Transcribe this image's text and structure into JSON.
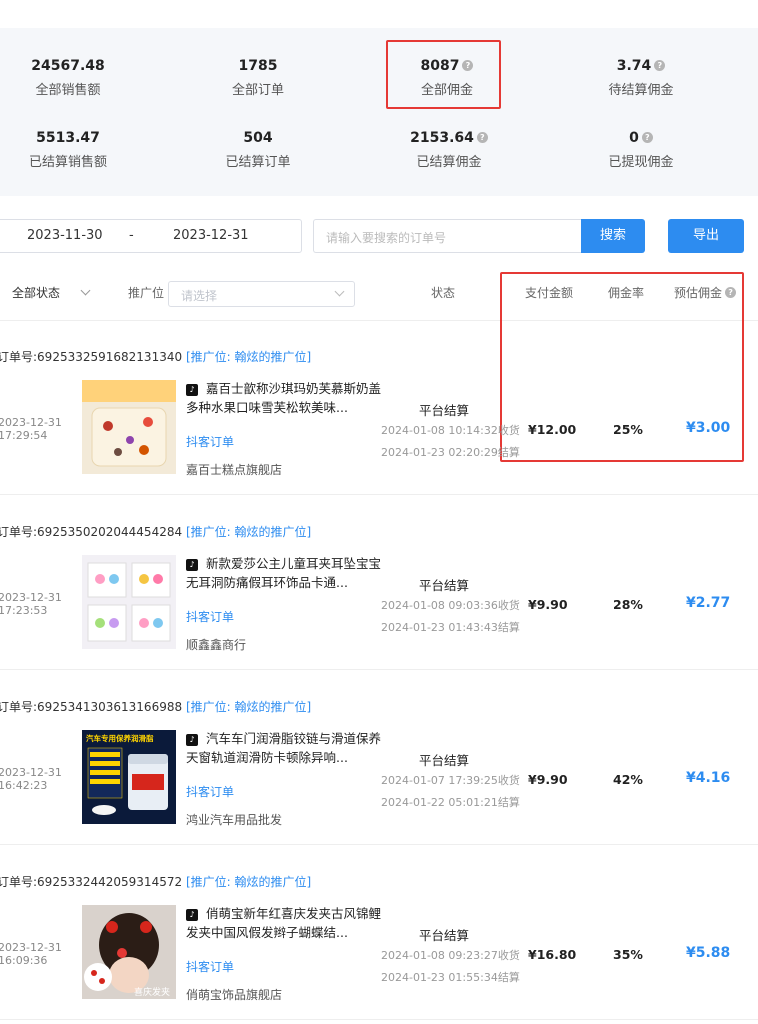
{
  "stats": [
    {
      "value": "24567.48",
      "label": "全部销售额",
      "info": false
    },
    {
      "value": "1785",
      "label": "全部订单",
      "info": false
    },
    {
      "value": "8087",
      "label": "全部佣金",
      "info": true
    },
    {
      "value": "3.74",
      "label": "待结算佣金",
      "info": true
    },
    {
      "value": "5513.47",
      "label": "已结算销售额",
      "info": false
    },
    {
      "value": "504",
      "label": "已结算订单",
      "info": false
    },
    {
      "value": "2153.64",
      "label": "已结算佣金",
      "info": true
    },
    {
      "value": "0",
      "label": "已提现佣金",
      "info": true
    }
  ],
  "filters": {
    "start_date": "2023-11-30",
    "date_sep": "-",
    "end_date": "2023-12-31",
    "search_placeholder": "请输入要搜索的订单号",
    "search_label": "搜索",
    "export_label": "导出",
    "status_filter": "全部状态",
    "position_label": "推广位",
    "position_placeholder": "请选择"
  },
  "columns": {
    "status": "状态",
    "pay_amount": "支付金额",
    "rate": "佣金率",
    "est_commission": "预估佣金"
  },
  "orders": [
    {
      "order_label": "订单号:",
      "order_no": "6925332591682131340",
      "position_tag": "[推广位: 翰炫的推广位]",
      "date": "2023-12-31",
      "time": "17:29:54",
      "title": "嘉百士歆称沙琪玛奶芙慕斯奶盖多种水果口味雪芙松软美味...",
      "source": "抖客订单",
      "shop": "嘉百士糕点旗舰店",
      "status": "平台结算",
      "ts1": "2024-01-08 10:14:32收货",
      "ts2": "2024-01-23 02:20:29结算",
      "pay": "¥12.00",
      "rate": "25%",
      "commission": "¥3.00",
      "thumb": "snack-image"
    },
    {
      "order_label": "订单号:",
      "order_no": "6925350202044454284",
      "position_tag": "[推广位: 翰炫的推广位]",
      "date": "2023-12-31",
      "time": "17:23:53",
      "title": "新款爱莎公主儿童耳夹耳坠宝宝无耳洞防痛假耳环饰品卡通...",
      "source": "抖客订单",
      "shop": "顺鑫鑫商行",
      "status": "平台结算",
      "ts1": "2024-01-08 09:03:36收货",
      "ts2": "2024-01-23 01:43:43结算",
      "pay": "¥9.90",
      "rate": "28%",
      "commission": "¥2.77",
      "thumb": "earring-image"
    },
    {
      "order_label": "订单号:",
      "order_no": "6925341303613166988",
      "position_tag": "[推广位: 翰炫的推广位]",
      "date": "2023-12-31",
      "time": "16:42:23",
      "title": "汽车车门润滑脂铰链与滑道保养天窗轨道润滑防卡顿除异响...",
      "source": "抖客订单",
      "shop": "鸿业汽车用品批发",
      "status": "平台结算",
      "ts1": "2024-01-07 17:39:25收货",
      "ts2": "2024-01-22 05:01:21结算",
      "pay": "¥9.90",
      "rate": "42%",
      "commission": "¥4.16",
      "thumb": "grease-image",
      "thumb_text": "汽车专用保养润滑脂"
    },
    {
      "order_label": "订单号:",
      "order_no": "6925332442059314572",
      "position_tag": "[推广位: 翰炫的推广位]",
      "date": "2023-12-31",
      "time": "16:09:36",
      "title": "俏萌宝新年红喜庆发夹古风锦鲤发夹中国风假发辫子蝴蝶结...",
      "source": "抖客订单",
      "shop": "俏萌宝饰品旗舰店",
      "status": "平台结算",
      "ts1": "2024-01-08 09:23:27收货",
      "ts2": "2024-01-23 01:55:34结算",
      "pay": "¥16.80",
      "rate": "35%",
      "commission": "¥5.88",
      "thumb": "hairclip-image",
      "thumb_text": "喜庆发夹"
    }
  ]
}
